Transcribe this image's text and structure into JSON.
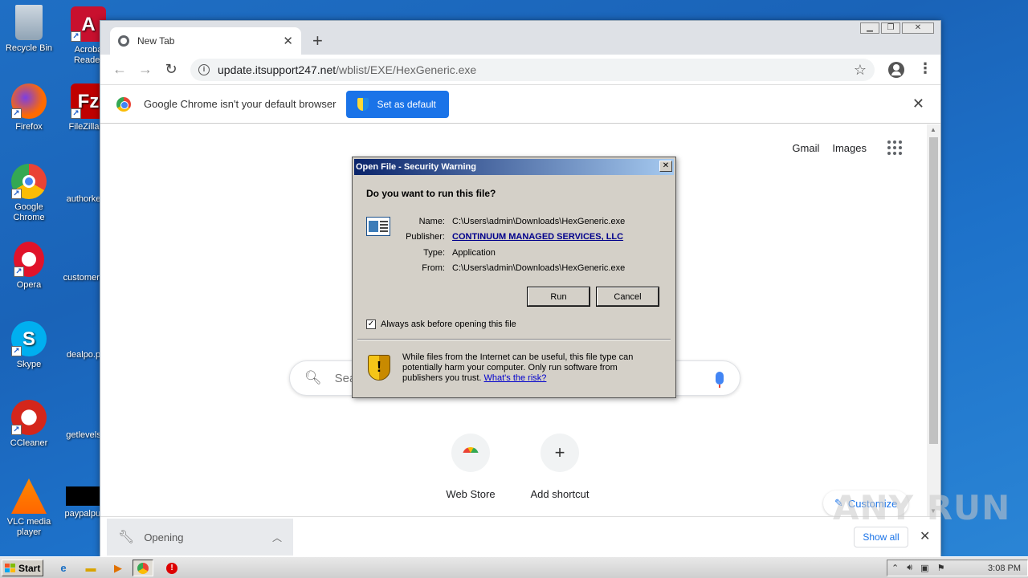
{
  "desktop": {
    "icons": [
      {
        "label": "Recycle Bin",
        "icon": "recycle-bin-icon"
      },
      {
        "label": "Firefox",
        "icon": "firefox-icon"
      },
      {
        "label": "Google Chrome",
        "icon": "chrome-icon"
      },
      {
        "label": "Opera",
        "icon": "opera-icon"
      },
      {
        "label": "Skype",
        "icon": "skype-icon"
      },
      {
        "label": "CCleaner",
        "icon": "ccleaner-icon"
      },
      {
        "label": "VLC media player",
        "icon": "vlc-icon"
      }
    ],
    "icons_col2": [
      {
        "label": "Acroba Reader",
        "icon": "acrobat-icon"
      },
      {
        "label": "FileZilla C",
        "icon": "filezilla-icon"
      },
      {
        "label": "authorke",
        "icon": "file-icon"
      },
      {
        "label": "customers",
        "icon": "file-icon"
      },
      {
        "label": "dealpo.p",
        "icon": "file-icon"
      },
      {
        "label": "getlevels",
        "icon": "file-icon"
      },
      {
        "label": "paypalpul",
        "icon": "file-icon"
      }
    ]
  },
  "browser": {
    "tab_title": "New Tab",
    "url_host": "update.itsupport247.net",
    "url_path": "/wblist/EXE/HexGeneric.exe",
    "infobar_text": "Google Chrome isn't your default browser",
    "set_default_label": "Set as default",
    "links": {
      "gmail": "Gmail",
      "images": "Images"
    },
    "search_placeholder": "Sea",
    "shortcuts": [
      {
        "label": "Web Store"
      },
      {
        "label": "Add shortcut"
      }
    ],
    "customize_label": "Customize",
    "download": {
      "item_label": "Opening",
      "show_all": "Show all"
    }
  },
  "dialog": {
    "title": "Open File - Security Warning",
    "question": "Do you want to run this file?",
    "fields": [
      {
        "label": "Name:",
        "value": "C:\\Users\\admin\\Downloads\\HexGeneric.exe"
      },
      {
        "label": "Publisher:",
        "value": "CONTINUUM MANAGED SERVICES, LLC"
      },
      {
        "label": "Type:",
        "value": "Application"
      },
      {
        "label": "From:",
        "value": "C:\\Users\\admin\\Downloads\\HexGeneric.exe"
      }
    ],
    "run_label": "Run",
    "cancel_label": "Cancel",
    "checkbox_label": "Always ask before opening this file",
    "checkbox_checked": true,
    "warning_text": "While files from the Internet can be useful, this file type can potentially harm your computer. Only run software from publishers you trust.",
    "warning_link": "What's the risk?"
  },
  "taskbar": {
    "start_label": "Start",
    "clock": "3:08 PM"
  },
  "watermark": "ANY RUN"
}
